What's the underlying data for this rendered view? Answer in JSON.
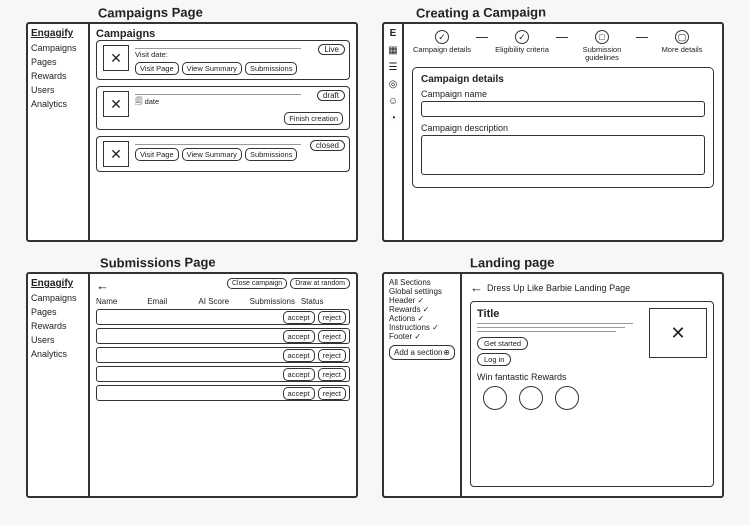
{
  "brand": "Engagify",
  "nav": [
    "Campaigns",
    "Pages",
    "Rewards",
    "Users",
    "Analytics"
  ],
  "panels": {
    "campaigns": {
      "title": "Campaigns Page",
      "heading": "Campaigns",
      "cards": [
        {
          "status": "Live",
          "meta_label": "Visit date:",
          "buttons": [
            "Visit Page",
            "View Summary",
            "Submissions"
          ]
        },
        {
          "status": "draft",
          "meta_label": "date",
          "buttons": [
            "Finish creation"
          ]
        },
        {
          "status": "closed",
          "meta_label": "",
          "buttons": [
            "Visit Page",
            "View Summary",
            "Submissions"
          ]
        }
      ]
    },
    "create": {
      "title": "Creating a Campaign",
      "side_letter": "E",
      "steps": [
        {
          "icon": "✓",
          "label": "Campaign details"
        },
        {
          "icon": "✓",
          "label": "Eligibility criteria"
        },
        {
          "icon": "□",
          "label": "Submission guidelines"
        },
        {
          "icon": "▢",
          "label": "More details"
        }
      ],
      "section_title": "Campaign details",
      "field_name_label": "Campaign name",
      "field_desc_label": "Campaign description"
    },
    "submissions": {
      "title": "Submissions Page",
      "back": "←",
      "top_actions": [
        "Close campaign",
        "Draw at random"
      ],
      "columns": [
        "Name",
        "Email",
        "AI Score",
        "Submissions",
        "Status"
      ],
      "row_actions": {
        "accept": "accept",
        "reject": "reject"
      },
      "row_count": 5
    },
    "landing": {
      "title": "Landing page",
      "back": "←",
      "page_name": "Dress Up Like Barbie Landing Page",
      "sidebar_items": [
        {
          "label": "All Sections",
          "done": false
        },
        {
          "label": "Global settings",
          "done": false
        },
        {
          "label": "Header",
          "done": true
        },
        {
          "label": "Rewards",
          "done": true
        },
        {
          "label": "Actions",
          "done": true
        },
        {
          "label": "Instructions",
          "done": true
        },
        {
          "label": "Footer",
          "done": true
        }
      ],
      "add_section": "Add a section",
      "preview": {
        "title": "Title",
        "cta1": "Get started",
        "cta2": "Log in",
        "rewards_title": "Win fantastic Rewards"
      }
    }
  }
}
